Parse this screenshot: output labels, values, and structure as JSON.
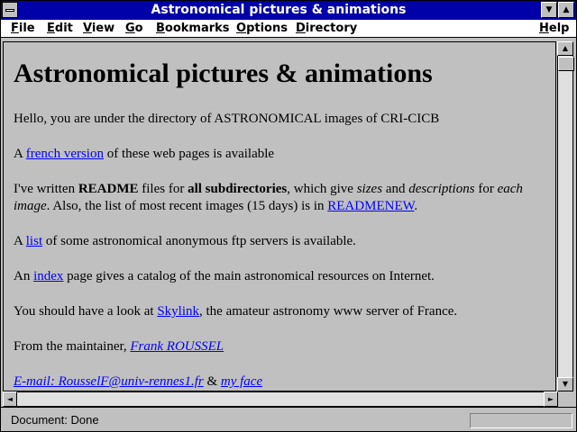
{
  "window": {
    "title": "Astronomical pictures & animations",
    "min_glyph": "▼",
    "max_glyph": "▲"
  },
  "menu": {
    "file": "File",
    "edit": "Edit",
    "view": "View",
    "go": "Go",
    "bookmarks": "Bookmarks",
    "options": "Options",
    "directory": "Directory",
    "help": "Help"
  },
  "page": {
    "heading": "Astronomical pictures & animations",
    "p1": "Hello, you are under the directory of ASTRONOMICAL images of CRI-CICB",
    "p2": {
      "pre": "A ",
      "link": "french version",
      "post": " of these web pages is available"
    },
    "p3": {
      "t1": "I've written ",
      "b1": "README",
      "t2": " files for ",
      "b2": "all subdirectories",
      "t3": ", which give ",
      "i1": "sizes",
      "t4": " and ",
      "i2": "descriptions",
      "t5": " for ",
      "i3": "each image",
      "t6": ". Also, the list of most recent images (15 days) is in ",
      "link": "READMENEW",
      "t7": "."
    },
    "p4": {
      "pre": "A ",
      "link": "list",
      "post": " of some astronomical anonymous ftp servers is available."
    },
    "p5": {
      "pre": "An ",
      "link": "index",
      "post": " page gives a catalog of the main astronomical resources on Internet."
    },
    "p6": {
      "pre": "You should have a look at ",
      "link": "Skylink",
      "post": ", the amateur astronomy www server of France."
    },
    "p7": {
      "pre": "From the maintainer, ",
      "link": "Frank ROUSSEL"
    },
    "p8": {
      "email": "E-mail: RousselF@univ-rennes1.fr",
      "amp": " & ",
      "face": "my face"
    }
  },
  "scroll": {
    "up": "▲",
    "down": "▼",
    "left": "◄",
    "right": "►"
  },
  "status": {
    "text": "Document: Done"
  },
  "colors": {
    "titlebar": "#0000a8",
    "background": "#c0c0c0",
    "link": "#0000ff"
  }
}
